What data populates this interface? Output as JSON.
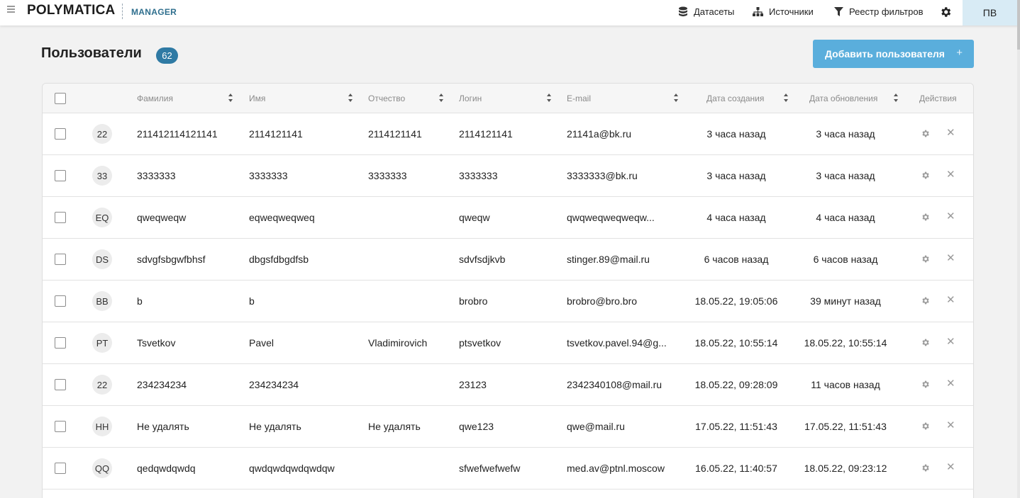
{
  "app": {
    "logo": "POLYMATICA",
    "logo_sub": "MANAGER"
  },
  "nav": [
    {
      "label": "Датасеты",
      "icon": "database-icon"
    },
    {
      "label": "Источники",
      "icon": "sitemap-icon"
    },
    {
      "label": "Реестр фильтров",
      "icon": "filter-icon"
    }
  ],
  "user": {
    "initials": "ПВ"
  },
  "page": {
    "title": "Пользователи",
    "count": "62",
    "add_button": "Добавить пользователя",
    "add_icon": "+"
  },
  "colors": {
    "accent": "#5aaedc",
    "badge": "#2f7aa4",
    "brand_sub": "#2f6f8e"
  },
  "table": {
    "headers": {
      "lastname": "Фамилия",
      "firstname": "Имя",
      "middlename": "Отчество",
      "login": "Логин",
      "email": "E-mail",
      "created": "Дата создания",
      "updated": "Дата обновления",
      "actions": "Действия"
    },
    "rows": [
      {
        "initials": "22",
        "lastname": "211412114121141",
        "firstname": "2114121141",
        "middlename": "2114121141",
        "login": "2114121141",
        "email": "21141a@bk.ru",
        "created": "3 часа назад",
        "updated": "3 часа назад"
      },
      {
        "initials": "33",
        "lastname": "3333333",
        "firstname": "3333333",
        "middlename": "3333333",
        "login": "3333333",
        "email": "3333333@bk.ru",
        "created": "3 часа назад",
        "updated": "3 часа назад"
      },
      {
        "initials": "EQ",
        "lastname": "qweqweqw",
        "firstname": "eqweqweqweq",
        "middlename": "",
        "login": "qweqw",
        "email": "qwqweqweqweqw...",
        "created": "4 часа назад",
        "updated": "4 часа назад"
      },
      {
        "initials": "DS",
        "lastname": "sdvgfsbgwfbhsf",
        "firstname": "dbgsfdbgdfsb",
        "middlename": "",
        "login": "sdvfsdjkvb",
        "email": "stinger.89@mail.ru",
        "created": "6 часов назад",
        "updated": "6 часов назад"
      },
      {
        "initials": "BB",
        "lastname": "b",
        "firstname": "b",
        "middlename": "",
        "login": "brobro",
        "email": "brobro@bro.bro",
        "created": "18.05.22, 19:05:06",
        "updated": "39 минут назад"
      },
      {
        "initials": "PT",
        "lastname": "Tsvetkov",
        "firstname": "Pavel",
        "middlename": "Vladimirovich",
        "login": "ptsvetkov",
        "email": "tsvetkov.pavel.94@g...",
        "created": "18.05.22, 10:55:14",
        "updated": "18.05.22, 10:55:14"
      },
      {
        "initials": "22",
        "lastname": "234234234",
        "firstname": "234234234",
        "middlename": "",
        "login": "23123",
        "email": "2342340108@mail.ru",
        "created": "18.05.22, 09:28:09",
        "updated": "11 часов назад"
      },
      {
        "initials": "HH",
        "lastname": "Не удалять",
        "firstname": "Не удалять",
        "middlename": "Не удалять",
        "login": "qwe123",
        "email": "qwe@mail.ru",
        "created": "17.05.22, 11:51:43",
        "updated": "17.05.22, 11:51:43"
      },
      {
        "initials": "QQ",
        "lastname": "qedqwdqwdq",
        "firstname": "qwdqwdqwdqwdqw",
        "middlename": "",
        "login": "sfwefwefwefw",
        "email": "med.av@ptnl.moscow",
        "created": "16.05.22, 11:40:57",
        "updated": "18.05.22, 09:23:12"
      }
    ]
  }
}
